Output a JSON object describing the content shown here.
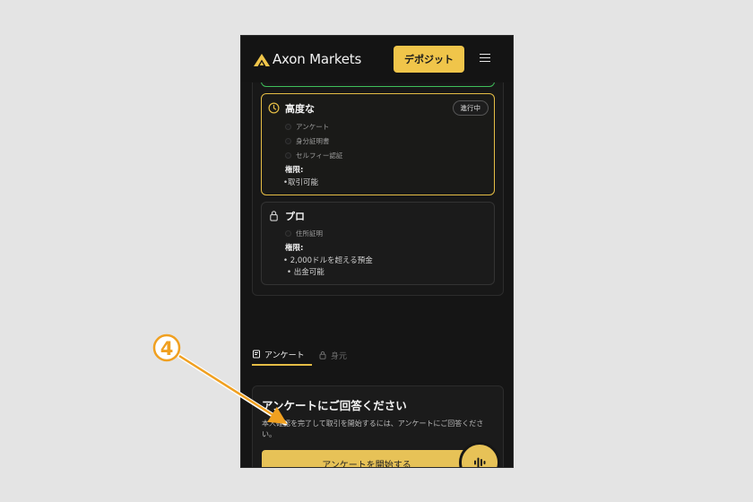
{
  "header": {
    "brand": "Axon Markets",
    "deposit_label": "デポジット",
    "menu_icon": "hamburger-icon"
  },
  "tiers": [
    {
      "name": "高度な",
      "icon": "clock-icon",
      "status": "進行中",
      "requirements": [
        "アンケート",
        "身分証明書",
        "セルフィー認証"
      ],
      "permissions_label": "権限:",
      "permissions": [
        "•取引可能"
      ]
    },
    {
      "name": "プロ",
      "icon": "lock-icon",
      "requirements": [
        "住所証明"
      ],
      "permissions_label": "権限:",
      "permissions": [
        "• 2,000ドルを超える預金",
        "• 出金可能"
      ]
    }
  ],
  "tabs": [
    {
      "label": "アンケート",
      "icon": "survey-icon",
      "active": true
    },
    {
      "label": "身元",
      "icon": "lock-icon",
      "active": false
    }
  ],
  "survey": {
    "title": "アンケートにご回答ください",
    "description": "本人確認を完了して取引を開始するには、アンケートにご回答ください。",
    "button_label": "アンケートを開始する"
  },
  "annotation": {
    "step_number": "4"
  },
  "colors": {
    "accent": "#f0c54a",
    "success": "#3fbf5a",
    "background": "#151515",
    "annotation": "#f0a020"
  }
}
